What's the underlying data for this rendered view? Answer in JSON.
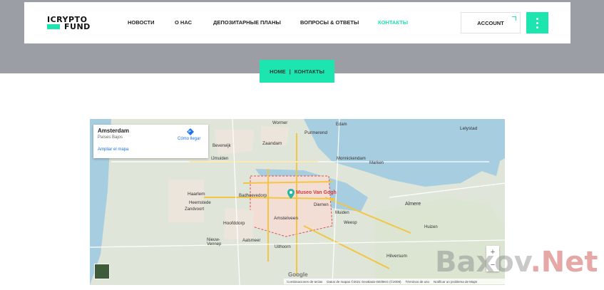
{
  "logo": {
    "line1": "ICRYPTO",
    "line2": "FUND"
  },
  "nav": [
    "НОВОСТИ",
    "О НАС",
    "ДЕПОЗИТАРНЫЕ ПЛАНЫ",
    "ВОПРОСЫ & ОТВЕТЫ",
    "КОНТАКТЫ"
  ],
  "account_label": "ACCOUNT",
  "breadcrumb": {
    "home": "HOME",
    "sep": "|",
    "current": "КОНТАКТЫ"
  },
  "map": {
    "city": "Amsterdam",
    "country": "Países Bajos",
    "bigger_map": "Ampliar el mapa",
    "directions": "Cómo llegar",
    "place_label": "Museo Van Gogh",
    "google": "Google",
    "footer": [
      "Combinaciones de teclas",
      "Datos de mapas ©2021 GeoBasis-DE/BKG (©2009)",
      "Términos de uso",
      "Notificar un problema de Maps"
    ],
    "labels": [
      "Zaandam",
      "Haarlem",
      "Hoofddorp",
      "Amstelveen",
      "Almere",
      "Lelystad",
      "Hilversum",
      "Purmerend",
      "Edam",
      "Monnickendam",
      "IJmuiden",
      "Zandvoort",
      "Heemstede",
      "Diemen",
      "Weesp",
      "Muiden",
      "Badhoevedorp",
      "Uithoorn",
      "Aalsmeer",
      "Beverwijk",
      "Nieuw-Vennep",
      "Huizen",
      "Wormer",
      "Marken"
    ]
  },
  "watermark": {
    "text": "Baxov",
    "tld": ".Net"
  },
  "colors": {
    "accent": "#1de5b0",
    "hero": "#9c9ea5"
  }
}
